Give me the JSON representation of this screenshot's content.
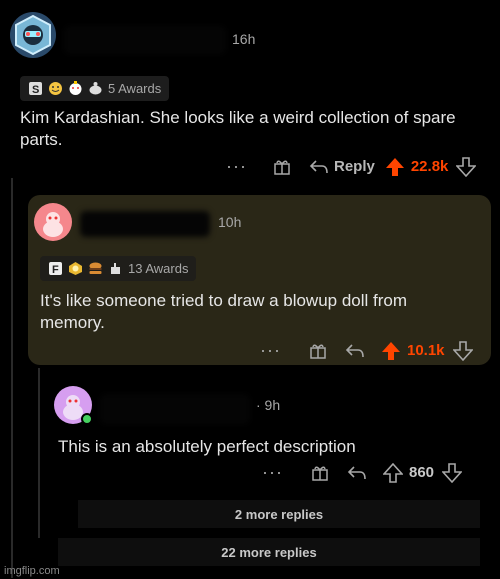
{
  "comment1": {
    "time": "16h",
    "awards_label": "5 Awards",
    "award_icons": [
      "silver-award-icon",
      "helpful-award-icon",
      "wholesome-award-icon",
      "snoo-award-icon"
    ],
    "text": "Kim Kardashian. She looks like a weird collection of spare parts.",
    "reply_label": "Reply",
    "score": "22.8k"
  },
  "comment2": {
    "time": "10h",
    "awards_label": "13 Awards",
    "award_icons": [
      "f-award-icon",
      "gold-award-icon",
      "burger-award-icon",
      "hand-award-icon"
    ],
    "text": "It's like someone tried to draw a blowup doll from memory.",
    "score": "10.1k",
    "highlight_color": "#2a2717"
  },
  "comment3": {
    "time": "· 9h",
    "text": "This is an absolutely perfect description",
    "score": "860"
  },
  "more_replies": "2 more replies",
  "more_replies_22": "22 more replies",
  "watermark": "imgflip.com",
  "colors": {
    "upvote": "#ff4500",
    "background": "#000000"
  }
}
